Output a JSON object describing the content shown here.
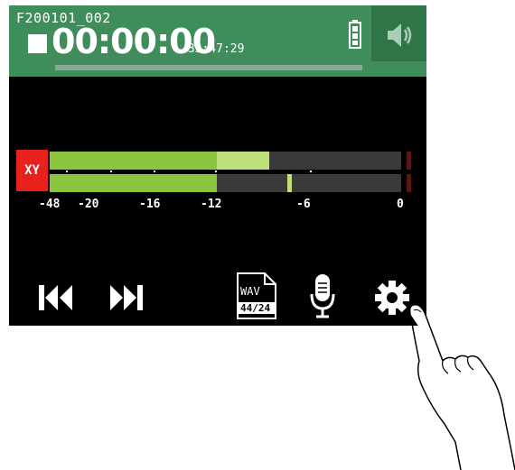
{
  "header": {
    "filename": "F200101_002",
    "timecode": "00:00:00",
    "remaining": "/33:47:29",
    "progress_fraction": 0.0
  },
  "meter": {
    "input_label": "XY",
    "channels": [
      {
        "level_fraction": 0.475,
        "peak_fraction": 0.625
      },
      {
        "level_fraction": 0.475,
        "peak_fraction": 0.675
      }
    ],
    "scale_labels": [
      "-48",
      "-20",
      "-16",
      "-12",
      "-6",
      "0"
    ]
  },
  "file_format": {
    "type": "WAV",
    "spec": "44/24"
  },
  "colors": {
    "header_bg": "#3f8d5a",
    "speaker_bg": "#2f7548",
    "input_badge": "#e8211c",
    "meter_level": "#8cc63f",
    "meter_peak": "#c0e07e"
  },
  "icons": [
    "battery-icon",
    "speaker-icon",
    "rewind-icon",
    "fast-forward-icon",
    "wav-file-icon",
    "microphone-icon",
    "settings-gear-icon",
    "pointing-hand"
  ]
}
